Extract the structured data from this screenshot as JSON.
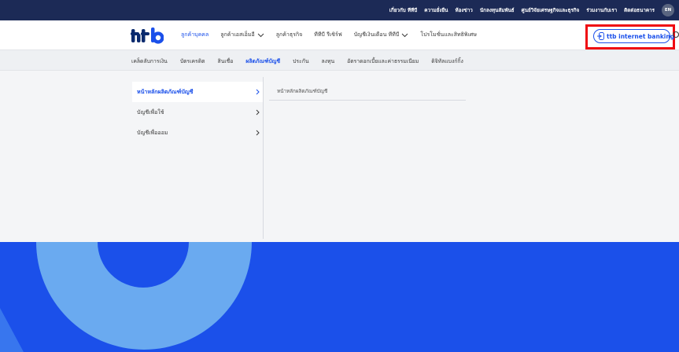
{
  "top_links": [
    "เกี่ยวกับ ทีทีบี",
    "ความยั่งยืน",
    "ห้องข่าว",
    "นักลงทุนสัมพันธ์",
    "ศูนย์วิจัยเศรษฐกิจและธุรกิจ",
    "ร่วมงานกับเรา",
    "ติดต่อธนาคาร"
  ],
  "language": "EN",
  "brand": {
    "logo_alt": "ttb",
    "accent": "#1b50ea",
    "highlight": "#ef0b12",
    "topbar": "#1c2a56"
  },
  "nav": [
    {
      "label": "ลูกค้าบุคคล",
      "active": true,
      "chevron": false
    },
    {
      "label": "ลูกค้าเอสเอ็มอี",
      "active": false,
      "chevron": true
    },
    {
      "label": "ลูกค้าธุรกิจ",
      "active": false,
      "chevron": false
    },
    {
      "label": "ทีทีบี รีเซิร์ฟ",
      "active": false,
      "chevron": false
    },
    {
      "label": "บัญชีเงินเดือน ทีทีบี",
      "active": false,
      "chevron": true
    },
    {
      "label": "โปรโมชั่นและสิทธิพิเศษ",
      "active": false,
      "chevron": false
    }
  ],
  "internet_banking": {
    "label": "ttb internet banking",
    "icon": "login-icon"
  },
  "subnav": [
    {
      "label": "เคล็ดลับการเงิน",
      "active": false
    },
    {
      "label": "บัตรเครดิต",
      "active": false
    },
    {
      "label": "สินเชื่อ",
      "active": false
    },
    {
      "label": "ผลิตภัณฑ์บัญชี",
      "active": true
    },
    {
      "label": "ประกัน",
      "active": false
    },
    {
      "label": "ลงทุน",
      "active": false
    },
    {
      "label": "อัตราดอกเบี้ยและค่าธรรมเนียม",
      "active": false
    },
    {
      "label": "ดิจิทัลแบงก์กิ้ง",
      "active": false
    }
  ],
  "dropdown": {
    "left_menu": [
      {
        "label": "หน้าหลักผลิตภัณฑ์บัญชี",
        "active": true
      },
      {
        "label": "บัญชีเพื่อใช้",
        "active": false
      },
      {
        "label": "บัญชีเพื่อออม",
        "active": false
      }
    ],
    "right_link": "หน้าหลักผลิตภัณฑ์บัญชี"
  }
}
